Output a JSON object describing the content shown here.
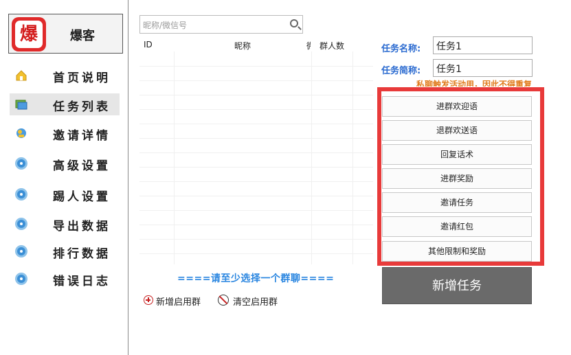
{
  "app": {
    "name": "爆客",
    "logo_char": "爆"
  },
  "sidebar": {
    "items": [
      {
        "label": "首页说明",
        "icon": "home-icon"
      },
      {
        "label": "任务列表",
        "icon": "task-list-icon",
        "active": true
      },
      {
        "label": "邀请详情",
        "icon": "invite-icon"
      },
      {
        "label": "高级设置",
        "icon": "gear-icon"
      },
      {
        "label": "踢人设置",
        "icon": "gear-icon"
      },
      {
        "label": "导出数据",
        "icon": "gear-icon"
      },
      {
        "label": "排行数据",
        "icon": "gear-icon"
      },
      {
        "label": "错误日志",
        "icon": "gear-icon"
      }
    ]
  },
  "search": {
    "placeholder": "昵称/微信号"
  },
  "table": {
    "columns": [
      "ID",
      "昵称",
      "微",
      "群人数"
    ]
  },
  "hint": "====请至少选择一个群聊====",
  "actions": {
    "add_group": "新增启用群",
    "clear_group": "清空启用群"
  },
  "task": {
    "name_label": "任务名称:",
    "name_value": "任务1",
    "short_label": "任务简称:",
    "short_value": "任务1",
    "note": "私聊触发活动用，因此不得重复"
  },
  "settings_buttons": [
    "进群欢迎语",
    "退群欢送语",
    "回复话术",
    "进群奖励",
    "邀请任务",
    "邀请红包",
    "其他限制和奖励"
  ],
  "new_task_button": "新增任务",
  "colors": {
    "accent": "#2a86e0",
    "highlight": "#e83a3a",
    "logo": "#e02a2a"
  }
}
